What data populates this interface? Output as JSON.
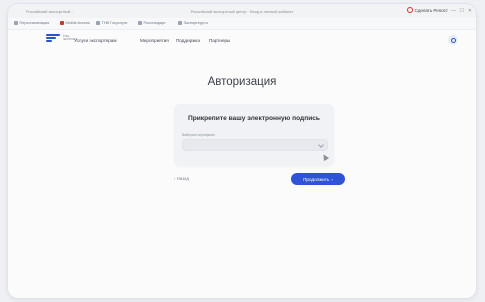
{
  "browser": {
    "tab_title": "Российский экспортный ...",
    "window_title": "Российский экспортный центр · Вход в личный кабинет",
    "record_label": "Сделать Репост",
    "window_controls": [
      "—",
      "☐",
      "✕"
    ],
    "bookmarks": [
      {
        "label": "Персонализация"
      },
      {
        "label": "Mobile Access"
      },
      {
        "label": "ТНВ Госуслуги"
      },
      {
        "label": "Росстандарт"
      },
      {
        "label": "Экспортеру.ru"
      }
    ]
  },
  "site": {
    "logo_text": [
      "РЭЦ",
      "ЭКСПОРТ"
    ],
    "nav": [
      "Услуги экспортерам",
      "Мероприятия",
      "Поддержка",
      "Партнеры"
    ]
  },
  "page": {
    "heading": "Авторизация",
    "card_title": "Прикрепите вашу электронную подпись",
    "field_label": "Выберите сертификат",
    "back_label": "Назад",
    "next_label": "Продолжить"
  },
  "colors": {
    "accent": "#2f53d6",
    "record": "#e0312b"
  }
}
